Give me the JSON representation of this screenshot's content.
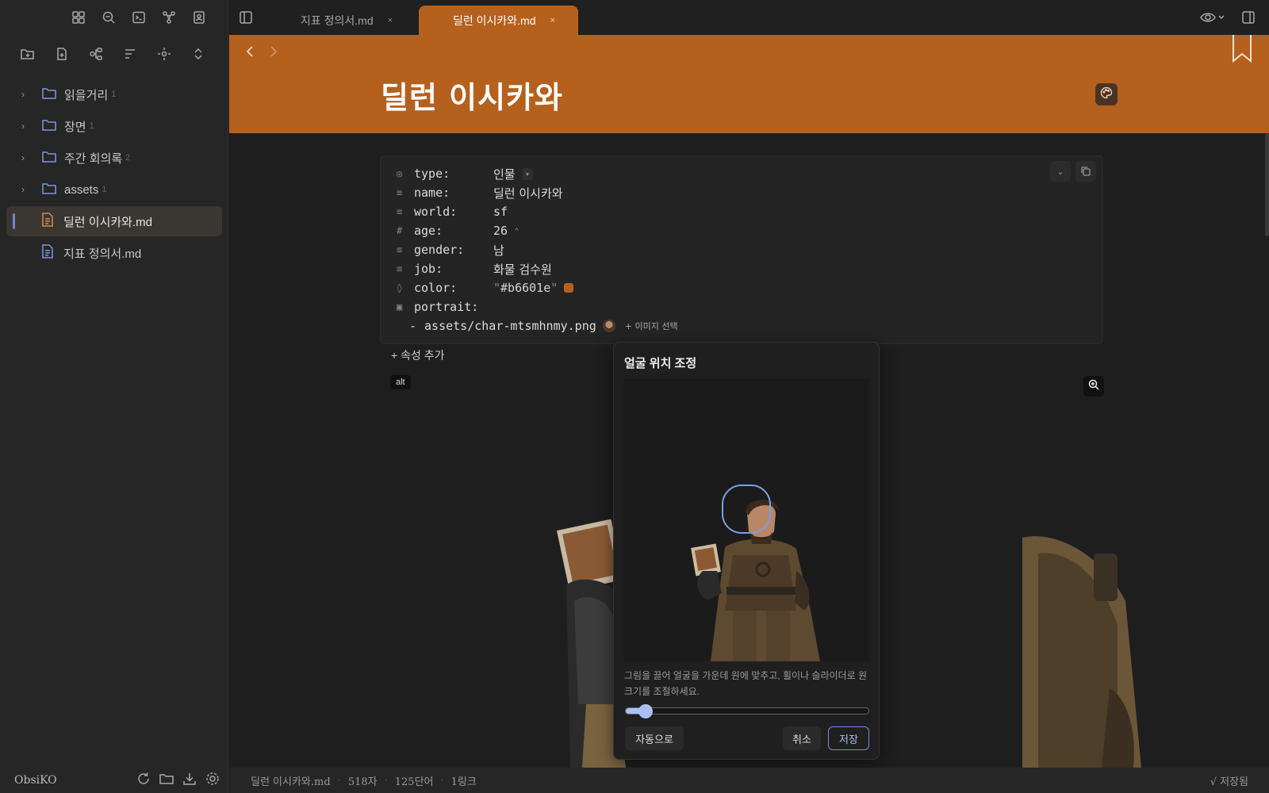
{
  "app": {
    "vault_name": "ObsiKO"
  },
  "colors": {
    "accent": "#b6601e",
    "selection_bar": "#6f86d6",
    "primary_button": "#6f8fe0"
  },
  "ribbon": {
    "icons": [
      "layout-grid-icon",
      "search-icon",
      "terminal-icon",
      "graph-icon",
      "contact-card-icon"
    ]
  },
  "file_nav": {
    "actions": [
      "new-folder-icon",
      "new-file-icon",
      "graph-view-icon",
      "sort-icon",
      "focus-icon",
      "collapse-expand-icon"
    ]
  },
  "tree": {
    "folders": [
      {
        "label": "읽을거리",
        "count": "1"
      },
      {
        "label": "장면",
        "count": "1"
      },
      {
        "label": "주간 회의록",
        "count": "2"
      },
      {
        "label": "assets",
        "count": "1"
      }
    ],
    "files": [
      {
        "label": "딜런 이시카와.md",
        "active": true
      },
      {
        "label": "지표 정의서.md",
        "active": false
      }
    ]
  },
  "tabs": [
    {
      "label": "지표 정의서.md",
      "close": "×",
      "active": false
    },
    {
      "label": "딜런 이시카와.md",
      "close": "×",
      "active": true
    }
  ],
  "note": {
    "title": "딜런 이시카와"
  },
  "properties": [
    {
      "icon": "◎",
      "key": "type:",
      "value": "인물",
      "extra": "▾"
    },
    {
      "icon": "≡",
      "key": "name:",
      "value": "딜런 이시카와"
    },
    {
      "icon": "≡",
      "key": "world:",
      "value": "sf"
    },
    {
      "icon": "#",
      "key": "age:",
      "value": "26",
      "extra": "⌃"
    },
    {
      "icon": "≡",
      "key": "gender:",
      "value": "남"
    },
    {
      "icon": "≡",
      "key": "job:",
      "value": "화물 검수원"
    },
    {
      "icon": "◊",
      "key": "color:",
      "value": "#b6601e",
      "quote": "\""
    },
    {
      "icon": "▣",
      "key": "portrait:",
      "value": ""
    }
  ],
  "portrait_item": {
    "dash": "-",
    "path": "assets/char-mtsmhnmy.png",
    "select_label": "+ 이미지 선택"
  },
  "add_property_label": "+ 속성 추가",
  "image": {
    "alt_badge": "alt"
  },
  "dialog": {
    "title": "얼굴 위치 조정",
    "hint": "그림을 끌어 얼굴을 가운데 원에 맞추고, 휠이나 슬라이더로 원 크기를 조절하세요.",
    "slider_value": 0.04,
    "auto_label": "자동으로",
    "cancel_label": "취소",
    "save_label": "저장"
  },
  "status": {
    "file": "딜런 이시카와.md",
    "chars": "518자",
    "words": "125단어",
    "links": "1링크",
    "saved": "√ 저장됨"
  }
}
